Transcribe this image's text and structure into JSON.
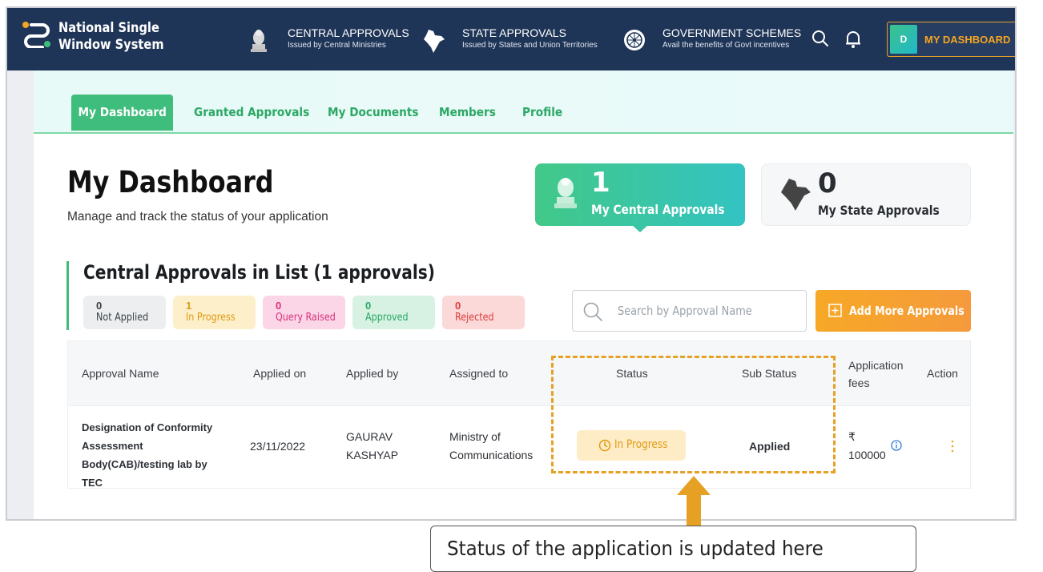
{
  "header": {
    "logo_line1": "National Single",
    "logo_line2": "Window System",
    "nav": [
      {
        "title": "CENTRAL APPROVALS",
        "subtitle": "Issued by Central Ministries",
        "icon": "emblem-icon"
      },
      {
        "title": "STATE APPROVALS",
        "subtitle": "Issued by States and Union Territories",
        "icon": "india-map-icon"
      },
      {
        "title": "GOVERNMENT SCHEMES",
        "subtitle": "Avail the benefits of Govt incentives",
        "icon": "ashoka-chakra-icon"
      }
    ],
    "avatar_initial": "D",
    "user_menu_label": "MY DASHBOARD"
  },
  "tabs": [
    "My Dashboard",
    "Granted Approvals",
    "My Documents",
    "Members",
    "Profile"
  ],
  "page": {
    "title": "My Dashboard",
    "subtitle": "Manage and track the status of your application"
  },
  "summary_cards": [
    {
      "count": "1",
      "label": "My Central Approvals"
    },
    {
      "count": "0",
      "label": "My State Approvals"
    }
  ],
  "section": {
    "title": "Central Approvals in List (1 approvals)",
    "chips": [
      {
        "count": "0",
        "label": "Not Applied",
        "bg": "#eceeef",
        "fg": "#3b4046"
      },
      {
        "count": "1",
        "label": "In Progress",
        "bg": "#fdefc9",
        "fg": "#e09a12"
      },
      {
        "count": "0",
        "label": "Query Raised",
        "bg": "#fbd6e7",
        "fg": "#d9317c"
      },
      {
        "count": "0",
        "label": "Approved",
        "bg": "#d7f2e3",
        "fg": "#2aa864"
      },
      {
        "count": "0",
        "label": "Rejected",
        "bg": "#fbd9d9",
        "fg": "#e03b3b"
      }
    ],
    "search_placeholder": "Search by Approval Name",
    "add_button_label": "Add More Approvals"
  },
  "table": {
    "columns": [
      "Approval Name",
      "Applied on",
      "Applied by",
      "Assigned to",
      "Status",
      "Sub Status",
      "Application fees",
      "Action"
    ],
    "rows": [
      {
        "approval_name": "Designation of Conformity Assessment Body(CAB)/testing lab by TEC",
        "applied_on": "23/11/2022",
        "applied_by": "GAURAV KASHYAP",
        "assigned_to": "Ministry of Communications",
        "status": "In Progress",
        "sub_status": "Applied",
        "fees_currency": "₹",
        "fees_amount": "100000"
      }
    ]
  },
  "annotation": {
    "callout_text": "Status of the application is updated here"
  },
  "colors": {
    "header_bg": "#1f3557",
    "brand_green": "#3fbd7c",
    "accent_orange": "#f5a623",
    "highlight": "#e6a124"
  }
}
